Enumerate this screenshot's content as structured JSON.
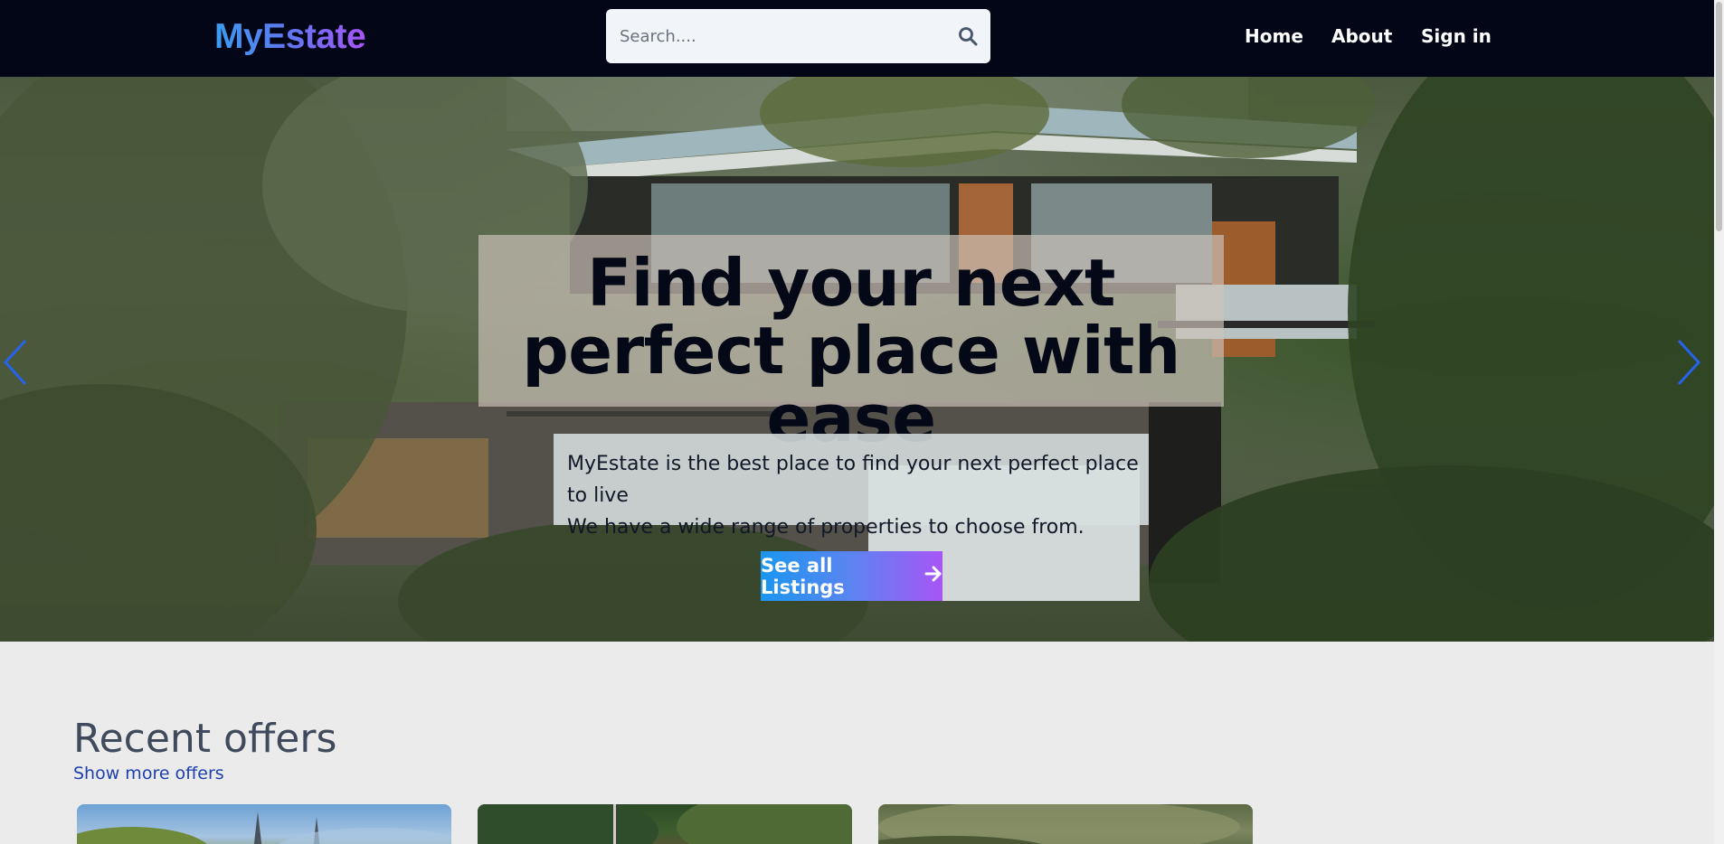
{
  "header": {
    "logo": "MyEstate",
    "search": {
      "placeholder": "Search...."
    },
    "nav": {
      "home": "Home",
      "about": "About",
      "sign_in": "Sign in"
    }
  },
  "hero": {
    "title": "Find your next perfect place with ease",
    "description_line1": "MyEstate is the best place to find your next perfect place to live",
    "description_line2": "We have a wide range of properties to choose from.",
    "cta_label": "See all Listings"
  },
  "offers": {
    "title": "Recent offers",
    "show_more": "Show more offers"
  },
  "colors": {
    "header_bg": "#020617",
    "accent_blue": "#1a96f0",
    "accent_purple": "#a855f7",
    "link": "#1e40af"
  },
  "icons": {
    "search": "search-icon",
    "prev": "chevron-left-icon",
    "next": "chevron-right-icon",
    "cta": "arrow-right-icon"
  }
}
